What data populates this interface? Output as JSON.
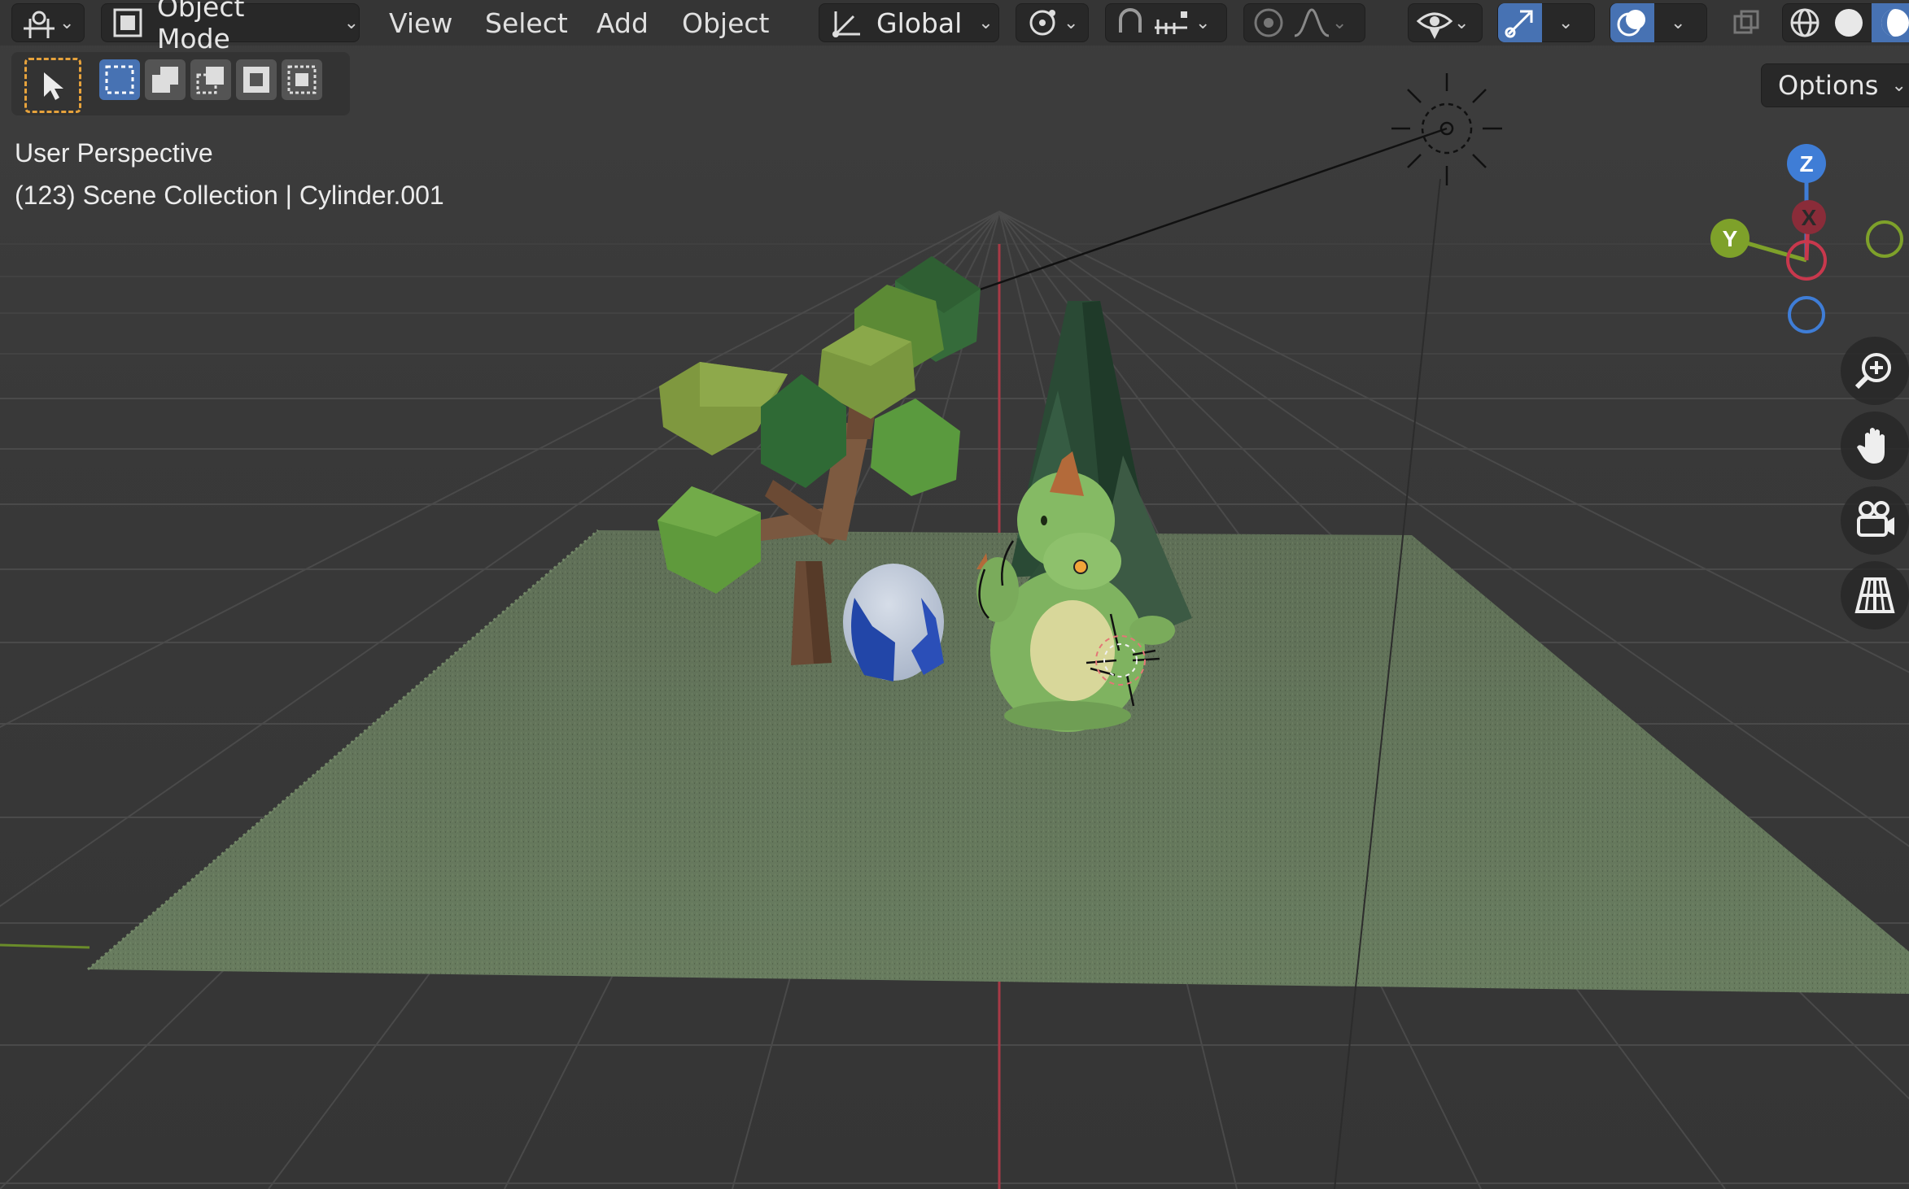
{
  "header": {
    "mode_label": "Object Mode",
    "menus": [
      "View",
      "Select",
      "Add",
      "Object"
    ],
    "transform_orientation": "Global",
    "options_label": "Options"
  },
  "overlay": {
    "view_name": "User Perspective",
    "scene_info": "(123) Scene Collection | Cylinder.001"
  },
  "gizmo": {
    "z_label": "Z",
    "y_label": "Y",
    "x_label": "X"
  },
  "colors": {
    "x_axis": "#c8384d",
    "y_axis": "#7ea12a",
    "z_axis": "#3f7dd6",
    "active_tool": "#e6a23c",
    "selected_highlight": "#4772b3",
    "grass": "#5e7155",
    "background": "#3a3a3a"
  },
  "icons": [
    "editor-type-icon",
    "object-mode-icon",
    "transform-orientation-icon",
    "pivot-icon",
    "snap-icon",
    "snap-increment-icon",
    "proportional-edit-icon",
    "falloff-icon",
    "visibility-icon",
    "gizmo-icon",
    "overlay-icon",
    "xray-icon",
    "wireframe-shading-icon",
    "solid-shading-icon",
    "material-shading-icon",
    "select-box-icon",
    "zoom-icon",
    "pan-hand-icon",
    "camera-icon",
    "grid-ortho-icon",
    "sun-lamp-icon"
  ]
}
